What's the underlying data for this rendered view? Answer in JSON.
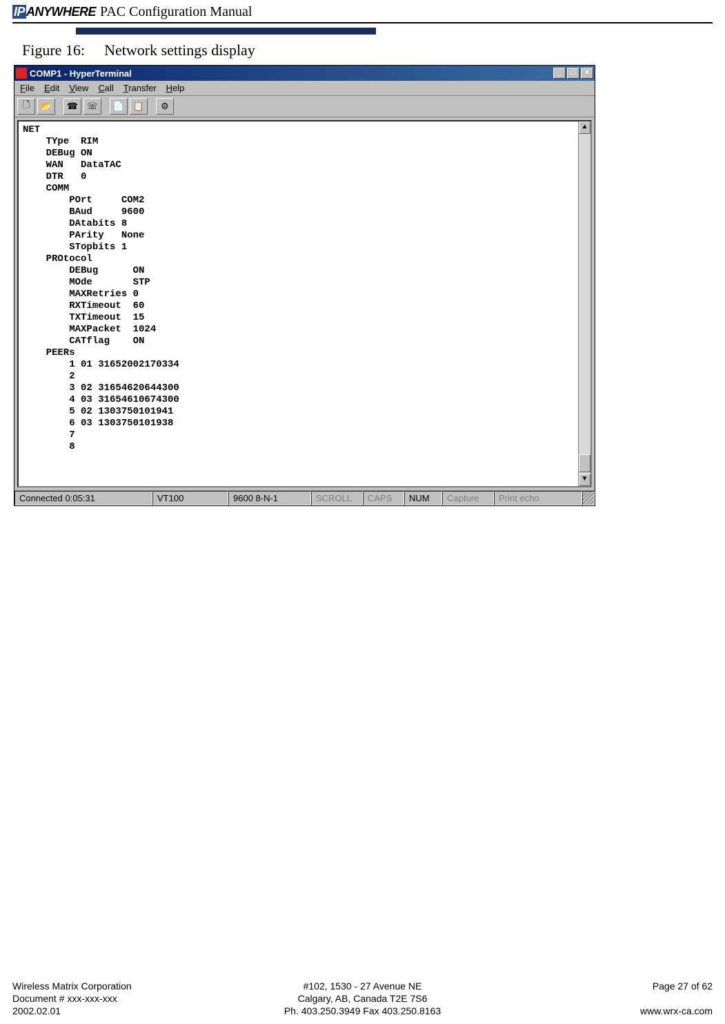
{
  "header": {
    "logo_ip": "IP",
    "logo_rest": "ANYWHERE",
    "title": "PAC Configuration Manual"
  },
  "figure": {
    "label": "Figure 16:",
    "caption": "Network settings display"
  },
  "window": {
    "title": "COMP1 - HyperTerminal",
    "menus": {
      "file": "File",
      "edit": "Edit",
      "view": "View",
      "call": "Call",
      "transfer": "Transfer",
      "help": "Help"
    },
    "btn_min": "_",
    "btn_max": "□",
    "btn_close": "×",
    "terminal_text": "NET\n    TYpe  RIM\n    DEBug ON\n    WAN   DataTAC\n    DTR   0\n    COMM\n        POrt     COM2\n        BAud     9600\n        DAtabits 8\n        PArity   None\n        STopbits 1\n    PROtocol\n        DEBug      ON\n        MOde       STP\n        MAXRetries 0\n        RXTimeout  60\n        TXTimeout  15\n        MAXPacket  1024\n        CATflag    ON\n    PEERs\n        1 01 31652002170334\n        2\n        3 02 31654620644300\n        4 03 31654610674300\n        5 02 1303750101941\n        6 03 1303750101938\n        7\n        8",
    "status": {
      "connected": "Connected 0:05:31",
      "emulation": "VT100",
      "settings": "9600 8-N-1",
      "scroll": "SCROLL",
      "caps": "CAPS",
      "num": "NUM",
      "capture": "Capture",
      "printecho": "Print echo"
    },
    "scroll_up": "▲",
    "scroll_down": "▼"
  },
  "footer": {
    "left1": "Wireless Matrix Corporation",
    "left2": "Document # xxx-xxx-xxx",
    "left3": "2002.02.01",
    "mid1": "#102, 1530 - 27 Avenue NE",
    "mid2": "Calgary, AB, Canada  T2E 7S6",
    "mid3": "Ph. 403.250.3949  Fax 403.250.8163",
    "right1": "Page 27 of 62",
    "right3": "www.wrx-ca.com"
  }
}
